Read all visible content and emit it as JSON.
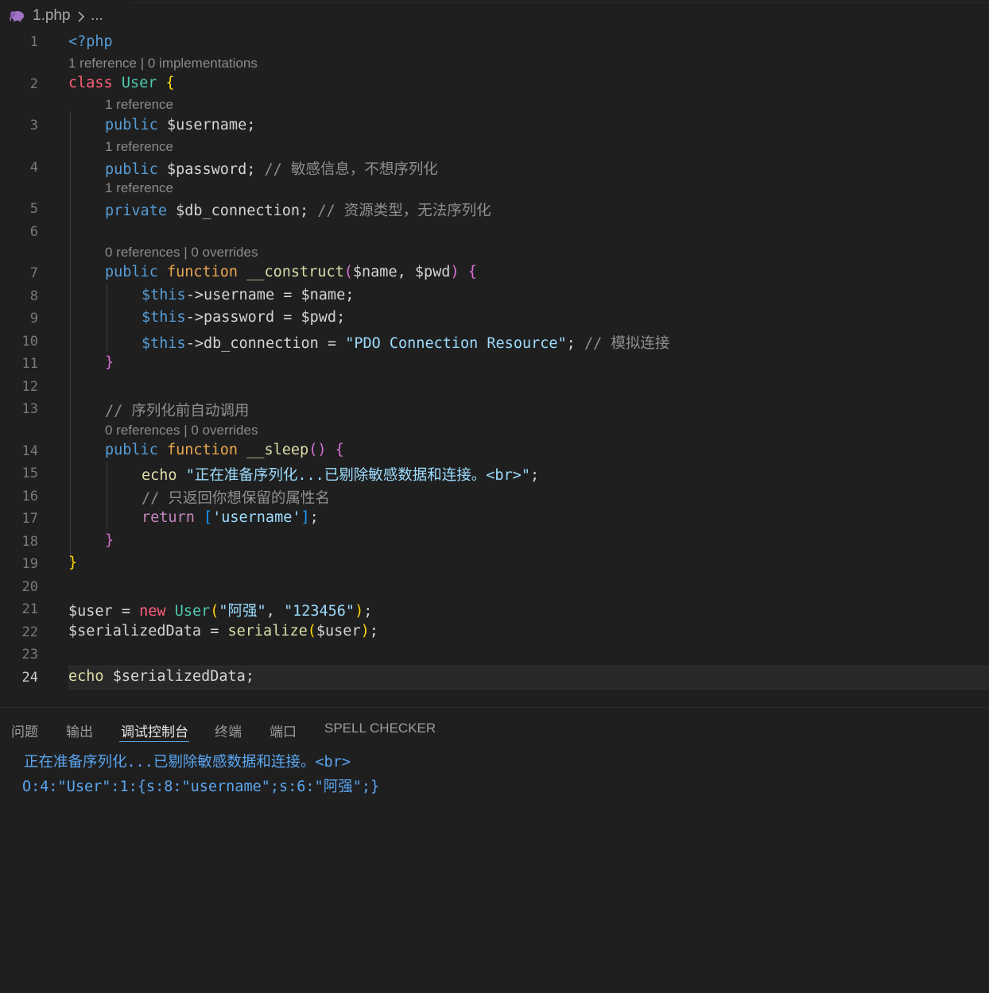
{
  "breadcrumb": {
    "file": "1.php",
    "rest": "..."
  },
  "lines": {
    "l1": "1",
    "l2": "2",
    "l3": "3",
    "l4": "4",
    "l5": "5",
    "l6": "6",
    "l7": "7",
    "l8": "8",
    "l9": "9",
    "l10": "10",
    "l11": "11",
    "l12": "12",
    "l13": "13",
    "l14": "14",
    "l15": "15",
    "l16": "16",
    "l17": "17",
    "l18": "18",
    "l19": "19",
    "l20": "20",
    "l21": "21",
    "l22": "22",
    "l23": "23",
    "l24": "24"
  },
  "codelens": {
    "class": "1 reference | 0 implementations",
    "username": "1 reference",
    "password": "1 reference",
    "db_connection": "1 reference",
    "construct": "0 references | 0 overrides",
    "sleep": "0 references | 0 overrides"
  },
  "code": {
    "php_open": "<?php",
    "kw_class": "class",
    "class_name": "User",
    "prop_username": "$username",
    "prop_password": "$password",
    "comment_password": "// 敏感信息，不想序列化",
    "kw_private": "private",
    "prop_db": "$db_connection",
    "comment_db": "// 资源类型，无法序列化",
    "kw_public": "public",
    "kw_function": "function",
    "fn_construct": "__construct",
    "param_name": "$name",
    "param_pwd": "$pwd",
    "this": "$this",
    "arrow": "->",
    "member_username": "username",
    "member_password": "password",
    "member_db": "db_connection",
    "str_pdo": "\"PDO Connection Resource\"",
    "comment_simulate": "// 模拟连接",
    "comment_sleep": "// 序列化前自动调用",
    "fn_sleep": "__sleep",
    "kw_echo": "echo",
    "str_prepare_a": "\"正在准备序列化...已剔除敏感数据和连接。",
    "str_br": "<br>",
    "str_quote_end": "\"",
    "comment_return": "// 只返回你想保留的属性名",
    "kw_return": "return",
    "str_username": "'username'",
    "var_user": "$user",
    "kw_new": "new",
    "str_aqiang": "\"阿强\"",
    "str_pwd": "\"123456\"",
    "var_serialized": "$serializedData",
    "fn_serialize": "serialize"
  },
  "panel": {
    "tabs": [
      "问题",
      "输出",
      "调试控制台",
      "终端",
      "端口",
      "SPELL CHECKER"
    ],
    "active_tab": "调试控制台",
    "output_line1": "正在准备序列化...已剔除敏感数据和连接。<br>",
    "output_line2": "O:4:\"User\":1:{s:8:\"username\";s:6:\"阿强\";}"
  },
  "colors": {
    "background": "#1f1f1f",
    "keyword_blue": "#569cd6",
    "keyword_orange": "#e8a64f",
    "class_teal": "#4ec9b0",
    "variable": "#9cdcfe",
    "string": "#ce9178",
    "comment": "#6a9955",
    "output_blue": "#5aa5f0"
  },
  "icons": {
    "file": "php-elephant-icon",
    "chevron": "chevron-right-icon"
  }
}
